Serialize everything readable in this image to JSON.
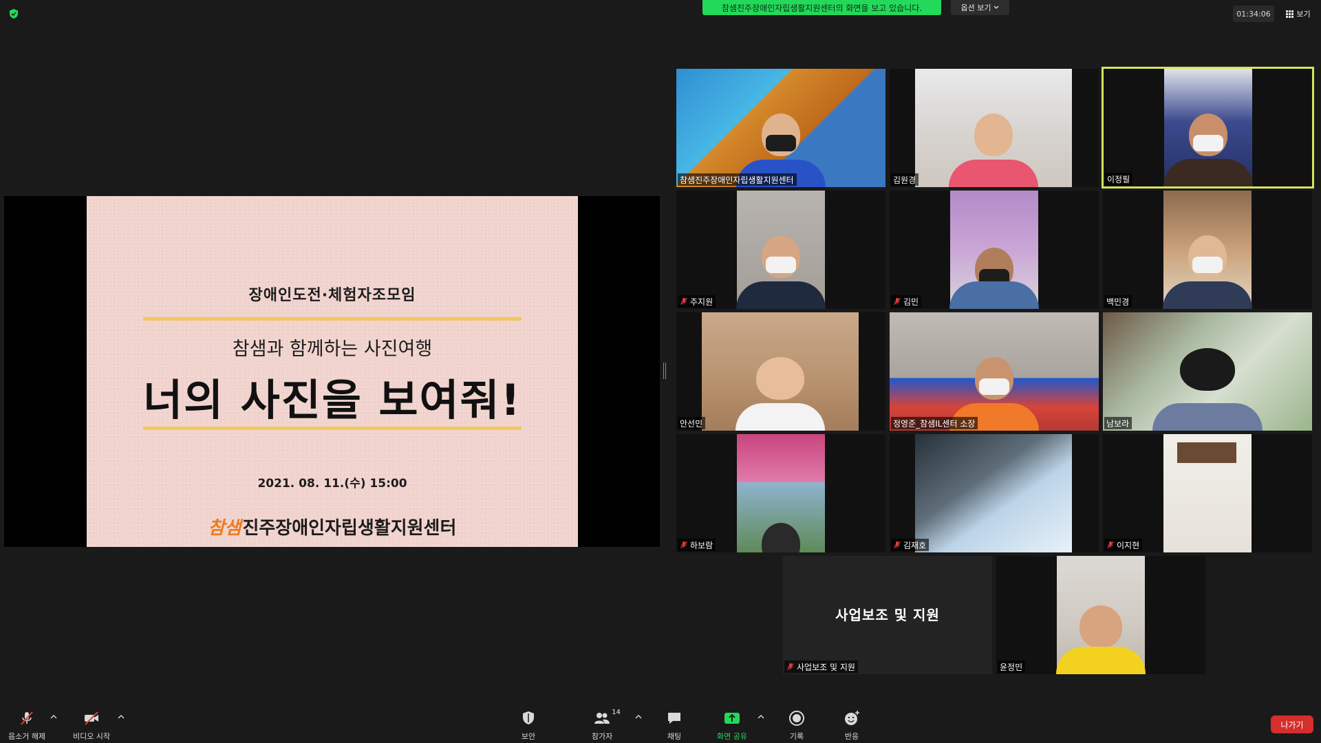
{
  "top_bar": {
    "share_banner": "참샘진주장애인자립생활지원센터의 화면을 보고 있습니다.",
    "view_options_label": "옵션 보기",
    "timer": "01:34:06",
    "view_label": "보기"
  },
  "slide": {
    "subtitle": "장애인도전·체험자조모임",
    "tagline": "참샘과 함께하는 사진여행",
    "title": "너의 사진을 보여줘!",
    "date": "2021. 08. 11.(수) 15:00",
    "logo_mark": "참샘",
    "org_name": "진주장애인자립생활지원센터"
  },
  "participants": [
    {
      "name": "참샘진주장애인자립생활지원센터",
      "muted": false
    },
    {
      "name": "김원경",
      "muted": false
    },
    {
      "name": "이정필",
      "muted": false,
      "active_speaker": true
    },
    {
      "name": "주지원",
      "muted": true
    },
    {
      "name": "김민",
      "muted": true
    },
    {
      "name": "백민경",
      "muted": false
    },
    {
      "name": "안선민",
      "muted": false
    },
    {
      "name": "정영준_참샘IL센터 소장",
      "muted": false
    },
    {
      "name": "남보라",
      "muted": false
    },
    {
      "name": "하보람",
      "muted": true
    },
    {
      "name": "김재호",
      "muted": true
    },
    {
      "name": "이지현",
      "muted": true
    },
    {
      "name": "사업보조 및 지원",
      "muted": true,
      "video_off_text": "사업보조 및 지원"
    },
    {
      "name": "윤정민",
      "muted": false
    }
  ],
  "toolbar": {
    "unmute": "음소거 해제",
    "start_video": "비디오 시작",
    "security": "보안",
    "participants": "참가자",
    "participants_count": "14",
    "chat": "채팅",
    "share_screen": "화면 공유",
    "record": "기록",
    "reactions": "반응",
    "leave": "나가기"
  },
  "colors": {
    "share_green": "#23d959",
    "active_speaker": "#d8e35b",
    "leave_red": "#d62d2d",
    "slide_bg": "#f1d3ce",
    "slide_rule": "#f0c95c",
    "logo_orange": "#ee7a1c",
    "mute_red": "#e23c3c"
  },
  "icons": {
    "security_shield": "shield-check-icon",
    "view_grid": "grid-icon",
    "mic_muted": "mic-slash-icon",
    "video_off": "video-slash-icon",
    "security": "shield-icon",
    "participants": "people-icon",
    "chat": "chat-bubble-icon",
    "share": "share-arrow-icon",
    "record": "record-icon",
    "reactions": "emoji-add-icon"
  }
}
